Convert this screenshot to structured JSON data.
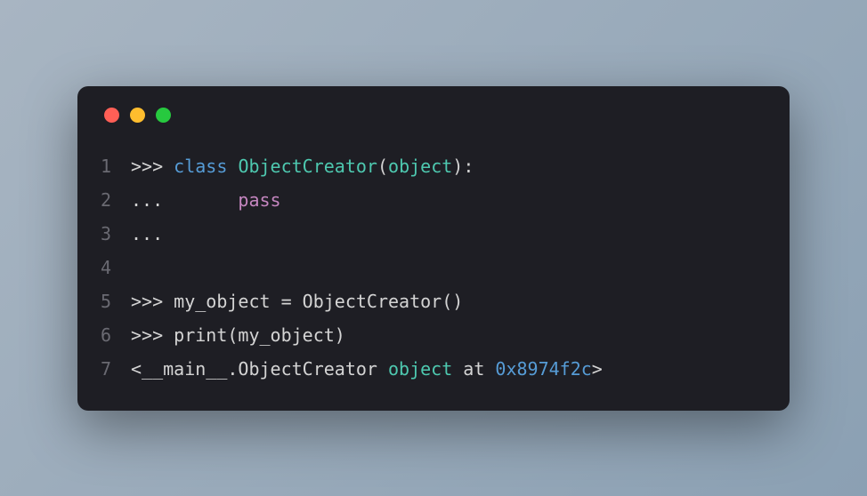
{
  "window": {
    "traffic_lights": [
      "red",
      "yellow",
      "green"
    ]
  },
  "code": {
    "lines": [
      {
        "num": "1",
        "tokens": [
          {
            "text": ">>> ",
            "cls": "tok-default"
          },
          {
            "text": "class",
            "cls": "tok-keyword"
          },
          {
            "text": " ",
            "cls": "tok-default"
          },
          {
            "text": "ObjectCreator",
            "cls": "tok-class"
          },
          {
            "text": "(",
            "cls": "tok-paren"
          },
          {
            "text": "object",
            "cls": "tok-builtin"
          },
          {
            "text": "):",
            "cls": "tok-paren"
          }
        ]
      },
      {
        "num": "2",
        "tokens": [
          {
            "text": "...       ",
            "cls": "tok-default"
          },
          {
            "text": "pass",
            "cls": "tok-pass"
          }
        ]
      },
      {
        "num": "3",
        "tokens": [
          {
            "text": "...",
            "cls": "tok-default"
          }
        ]
      },
      {
        "num": "4",
        "tokens": [
          {
            "text": "",
            "cls": "tok-default"
          }
        ]
      },
      {
        "num": "5",
        "tokens": [
          {
            "text": ">>> my_object = ObjectCreator()",
            "cls": "tok-default"
          }
        ]
      },
      {
        "num": "6",
        "tokens": [
          {
            "text": ">>> ",
            "cls": "tok-default"
          },
          {
            "text": "print",
            "cls": "tok-default"
          },
          {
            "text": "(my_object)",
            "cls": "tok-default"
          }
        ]
      },
      {
        "num": "7",
        "tokens": [
          {
            "text": "<__main__.ObjectCreator ",
            "cls": "tok-default"
          },
          {
            "text": "object",
            "cls": "tok-output-obj"
          },
          {
            "text": " at ",
            "cls": "tok-default"
          },
          {
            "text": "0x8974f2c",
            "cls": "tok-number"
          },
          {
            "text": ">",
            "cls": "tok-default"
          }
        ]
      }
    ]
  }
}
